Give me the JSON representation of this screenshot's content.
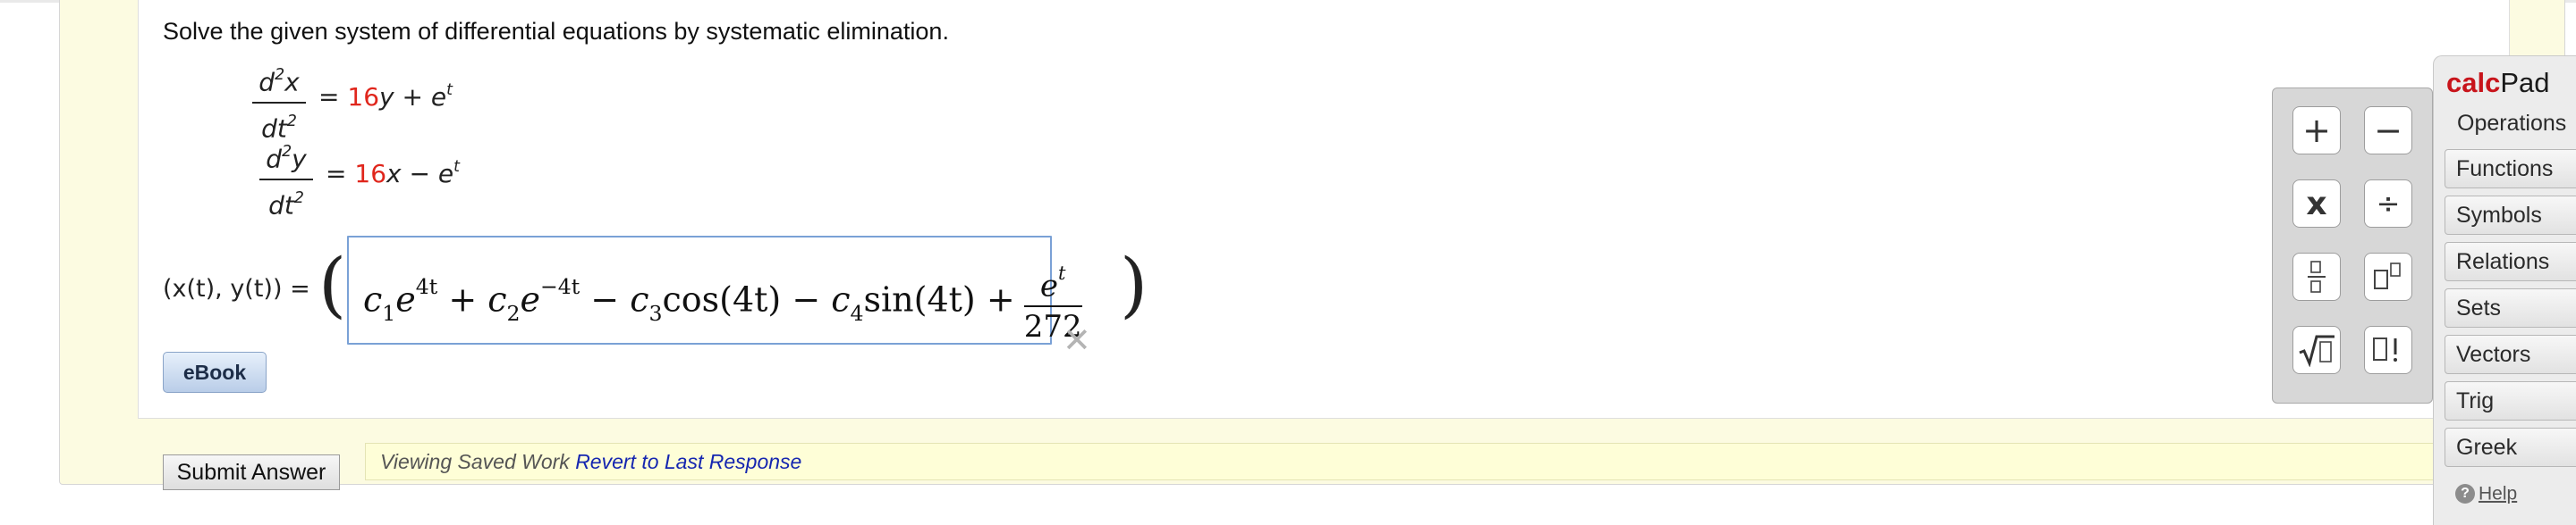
{
  "question": {
    "prompt": "Solve the given system of differential equations by systematic elimination."
  },
  "equations": [
    {
      "numerator": "d",
      "numerator_var": "x",
      "denominator": "dt",
      "rhs_coefficient": "16",
      "rhs_var": "y",
      "rhs_op": "+",
      "rhs_term": "e",
      "rhs_exp": "t"
    },
    {
      "numerator": "d",
      "numerator_var": "y",
      "denominator": "dt",
      "rhs_coefficient": "16",
      "rhs_var": "x",
      "rhs_op": "−",
      "rhs_term": "e",
      "rhs_exp": "t"
    }
  ],
  "answer": {
    "label": "(x(t), y(t)) =",
    "t1_c": "c",
    "t1_sub": "1",
    "t1_exp": "4t",
    "t2_c": "c",
    "t2_sub": "2",
    "t2_exp": "−4t",
    "t3_c": "c",
    "t3_sub": "3",
    "t3_fn": "cos(4t)",
    "t4_c": "c",
    "t4_sub": "4",
    "t4_fn": "sin(4t)",
    "frac_num": "e",
    "frac_num_exp": "t",
    "frac_den": "272"
  },
  "buttons": {
    "ebook": "eBook",
    "submit": "Submit Answer"
  },
  "saved": {
    "text": "Viewing Saved Work",
    "link": "Revert to Last Response"
  },
  "calcpad": {
    "title_red": "calc",
    "title_dark": "Pad",
    "operations": [
      "+",
      "−",
      "x",
      "÷",
      "fraction",
      "power",
      "sqrt",
      "factorial"
    ],
    "categories": [
      "Operations",
      "Functions",
      "Symbols",
      "Relations",
      "Sets",
      "Vectors",
      "Trig",
      "Greek"
    ],
    "help": "Help"
  },
  "colors": {
    "coefficient": "#e0261c",
    "answer_border": "#7aa1d6",
    "link": "#1526b0",
    "calcpad_red": "#c8141b"
  }
}
